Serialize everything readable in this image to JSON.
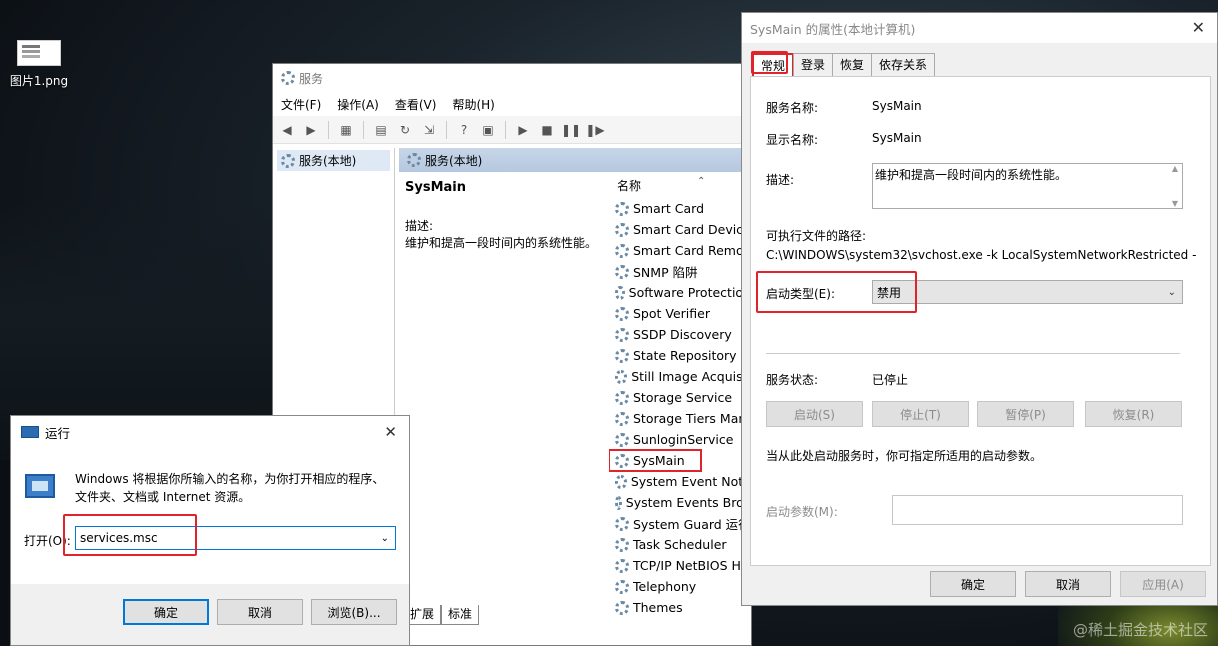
{
  "desktop": {
    "icon_label": "图片1.png",
    "watermark": "@稀土掘金技术社区"
  },
  "services_window": {
    "title": "服务",
    "menu": [
      "文件(F)",
      "操作(A)",
      "查看(V)",
      "帮助(H)"
    ],
    "tree_item": "服务(本地)",
    "pane_header": "服务(本地)",
    "selected_name": "SysMain",
    "desc_label": "描述:",
    "desc_text": "维护和提高一段时间内的系统性能。",
    "column_header": "名称",
    "rows": [
      "Smart Card",
      "Smart Card Device",
      "Smart Card Remov",
      "SNMP 陷阱",
      "Software Protection",
      "Spot Verifier",
      "SSDP Discovery",
      "State Repository S",
      "Still Image Acquisit",
      "Storage Service",
      "Storage Tiers Man",
      "SunloginService",
      "SysMain",
      "System Event Notif",
      "System Events Brok",
      "System Guard 运行",
      "Task Scheduler",
      "TCP/IP NetBIOS He",
      "Telephony",
      "Themes"
    ],
    "tabs": [
      "扩展",
      "标准"
    ]
  },
  "properties": {
    "title": "SysMain 的属性(本地计算机)",
    "tabs": [
      "常规",
      "登录",
      "恢复",
      "依存关系"
    ],
    "service_name_label": "服务名称:",
    "service_name": "SysMain",
    "display_name_label": "显示名称:",
    "display_name": "SysMain",
    "desc_label": "描述:",
    "desc": "维护和提高一段时间内的系统性能。",
    "path_label": "可执行文件的路径:",
    "path": "C:\\WINDOWS\\system32\\svchost.exe -k LocalSystemNetworkRestricted -",
    "startup_label": "启动类型(E):",
    "startup_value": "禁用",
    "status_label": "服务状态:",
    "status_value": "已停止",
    "btn_start": "启动(S)",
    "btn_stop": "停止(T)",
    "btn_pause": "暂停(P)",
    "btn_resume": "恢复(R)",
    "hint": "当从此处启动服务时，你可指定所适用的启动参数。",
    "param_label": "启动参数(M):",
    "ok": "确定",
    "cancel": "取消",
    "apply": "应用(A)"
  },
  "run_dialog": {
    "title": "运行",
    "text": "Windows 将根据你所输入的名称，为你打开相应的程序、文件夹、文档或 Internet 资源。",
    "open_label": "打开(O):",
    "input_value": "services.msc",
    "ok": "确定",
    "cancel": "取消",
    "browse": "浏览(B)..."
  },
  "colors": {
    "highlight_red": "#e0242b",
    "accent_blue": "#0078d7"
  }
}
